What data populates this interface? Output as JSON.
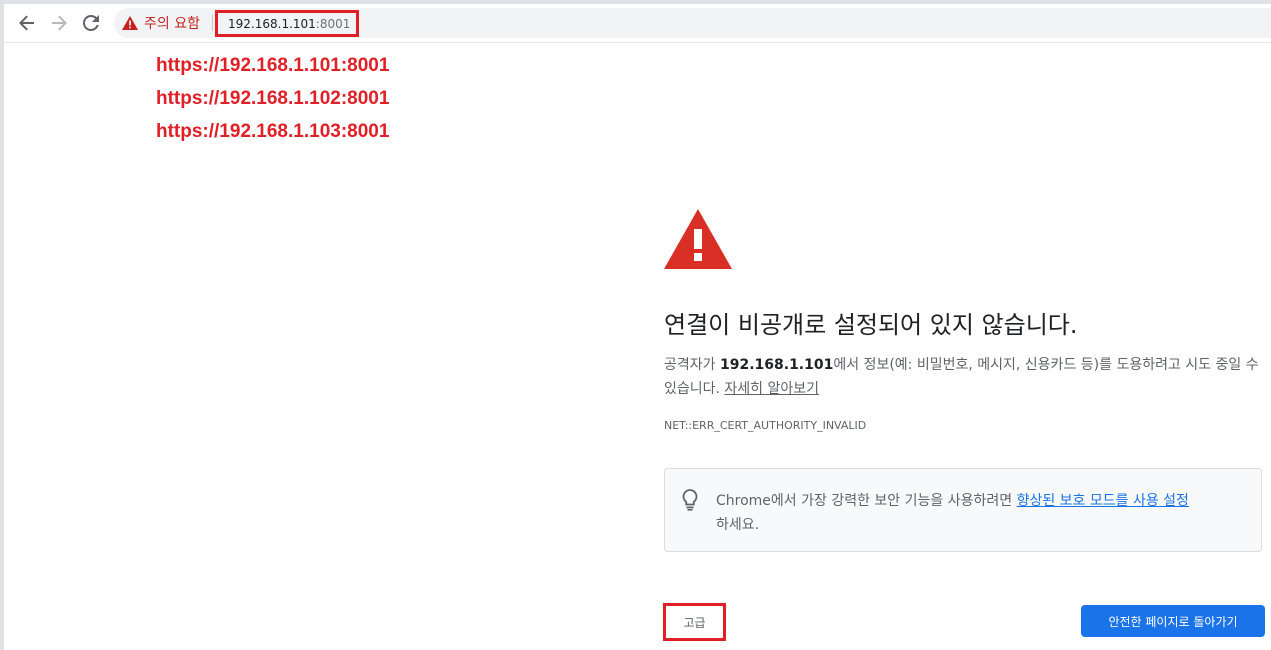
{
  "toolbar": {
    "back_icon": "arrow-back-icon",
    "forward_icon": "arrow-forward-icon",
    "reload_icon": "reload-icon",
    "security_chip_label": "주의 요함",
    "security_chip_icon": "warning-triangle-icon",
    "url_host": "192.168.1.101",
    "url_port": ":8001"
  },
  "annotations": [
    "https://192.168.1.101:8001",
    "https://192.168.1.102:8001",
    "https://192.168.1.103:8001"
  ],
  "interstitial": {
    "icon": "danger-triangle-icon",
    "heading": "연결이 비공개로 설정되어 있지 않습니다.",
    "explain_prefix": "공격자가 ",
    "explain_host": "192.168.1.101",
    "explain_suffix": "에서 정보(예: 비밀번호, 메시지, 신용카드 등)를 도용하려고 시도 중일 수 있습니다. ",
    "learn_more_link": "자세히 알아보기",
    "error_code": "NET::ERR_CERT_AUTHORITY_INVALID",
    "tip_icon": "lightbulb-icon",
    "tip_prefix": "Chrome에서 가장 강력한 보안 기능을 사용하려면 ",
    "tip_link": "향상된 보호 모드를 사용 설정",
    "tip_suffix": "하세요.",
    "advanced_button": "고급",
    "back_to_safety_button": "안전한 페이지로 돌아가기"
  },
  "colors": {
    "annotation_red": "#e01f26",
    "danger_red": "#d93025",
    "primary_blue": "#1a73e8"
  }
}
